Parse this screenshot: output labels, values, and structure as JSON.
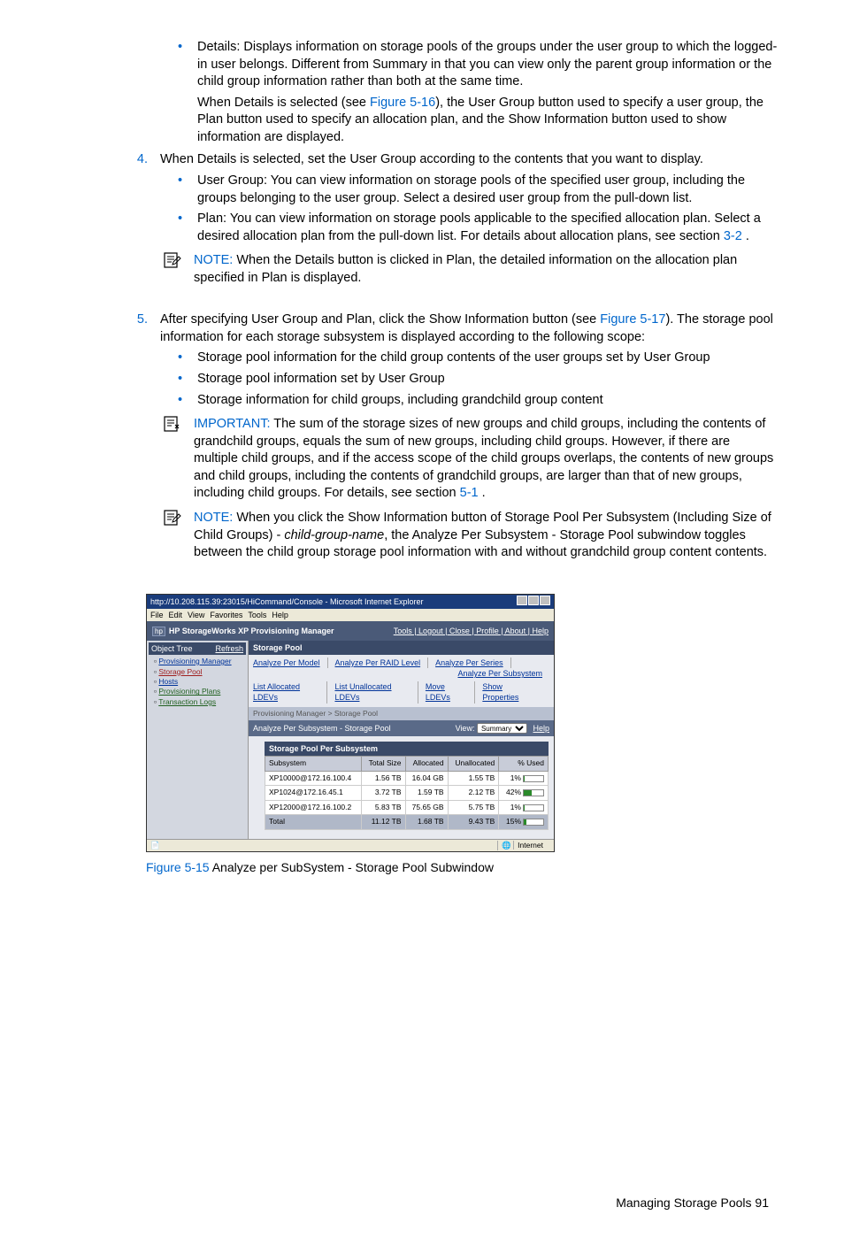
{
  "bullets_top": {
    "details_desc": "Details: Displays information on storage pools of the groups under the user group to which the logged-in user belongs. Different from Summary in that you can view only the parent group information or the child group information rather than both at the same time.",
    "details_para_before": "When Details is selected (see ",
    "details_link": "Figure 5-16",
    "details_para_after": "), the User Group button used to specify a user group, the Plan button used to specify an allocation plan, and the Show Information button used to show information are displayed."
  },
  "step4": {
    "num": "4.",
    "text": "When Details is selected, set the User Group according to the contents that you want to display.",
    "ug_bullet": "User Group: You can view information on storage pools of the specified user group, including the groups belonging to the user group. Select a desired user group from the pull-down list.",
    "plan_bullet_before": "Plan: You can view information on storage pools applicable to the specified allocation plan. Select a desired allocation plan from the pull-down list. For details about allocation plans, see section ",
    "plan_link": "3-2",
    "plan_bullet_after": " .",
    "note_label": "NOTE:  ",
    "note_text": "When the Details button is clicked in Plan, the detailed information on the allocation plan specified in Plan is displayed."
  },
  "step5": {
    "num": "5.",
    "text_before": "After specifying User Group and Plan, click the Show Information button (see ",
    "link": "Figure 5-17",
    "text_after": "). The storage pool information for each storage subsystem is displayed according to the following scope:",
    "b1": "Storage pool information for the child group contents of the user groups set by User Group",
    "b2": "Storage pool information set by User Group",
    "b3": "Storage information for child groups, including grandchild group content",
    "imp_label": "IMPORTANT:  ",
    "imp_before": "The sum of the storage sizes of new groups and child groups, including the contents of grandchild groups, equals the sum of new groups, including child groups. However, if there are multiple child groups, and if the access scope of the child groups overlaps, the contents of new groups and child groups, including the contents of grandchild groups, are larger than that of new groups, including child groups. For details, see section ",
    "imp_link": "5-1",
    "imp_after": " .",
    "note2_label": "NOTE:  ",
    "note2_before": "When you click the Show Information button of Storage Pool Per Subsystem (Including Size of Child Groups) - ",
    "note2_italic": "child-group-name",
    "note2_after": ", the Analyze Per Subsystem - Storage Pool subwindow toggles between the child group storage pool information with and without grandchild group content contents."
  },
  "faux": {
    "titlebar": "http://10.208.115.39:23015/HiCommand/Console - Microsoft Internet Explorer",
    "menus": [
      "File",
      "Edit",
      "View",
      "Favorites",
      "Tools",
      "Help"
    ],
    "appname": "HP StorageWorks XP Provisioning Manager",
    "applinks": "Tools | Logout | Close | Profile | About | Help",
    "tree_hdr": "Object Tree",
    "tree_refresh": "Refresh",
    "tree_items": [
      {
        "cls": "",
        "label": "Provisioning Manager"
      },
      {
        "cls": "red",
        "label": "Storage Pool"
      },
      {
        "cls": "",
        "label": "Hosts"
      },
      {
        "cls": "green",
        "label": "Provisioning Plans"
      },
      {
        "cls": "green",
        "label": "Transaction Logs"
      }
    ],
    "main_hdr": "Storage Pool",
    "linkbar1": [
      "Analyze Per Model",
      "Analyze Per RAID Level",
      "Analyze Per Series",
      "Analyze Per Subsystem"
    ],
    "linkbar2": [
      "List Allocated LDEVs",
      "List Unallocated LDEVs",
      "Move LDEVs",
      "Show Properties"
    ],
    "crumb": "Provisioning Manager > Storage Pool",
    "subhdr": "Analyze Per Subsystem - Storage Pool",
    "view_label": "View:",
    "view_opt": "Summary",
    "help": "Help",
    "tbl_title": "Storage Pool Per Subsystem",
    "cols": [
      "Subsystem",
      "Total Size",
      "Allocated",
      "Unallocated",
      "% Used"
    ],
    "rows": [
      {
        "sub": "XP10000@172.16.100.4",
        "total": "1.56 TB",
        "alloc": "16.04 GB",
        "unalloc": "1.55 TB",
        "used": "1%",
        "pct": 1
      },
      {
        "sub": "XP1024@172.16.45.1",
        "total": "3.72 TB",
        "alloc": "1.59 TB",
        "unalloc": "2.12 TB",
        "used": "42%",
        "pct": 42
      },
      {
        "sub": "XP12000@172.16.100.2",
        "total": "5.83 TB",
        "alloc": "75.65 GB",
        "unalloc": "5.75 TB",
        "used": "1%",
        "pct": 1
      }
    ],
    "total": {
      "sub": "Total",
      "total": "11.12 TB",
      "alloc": "1.68 TB",
      "unalloc": "9.43 TB",
      "used": "15%",
      "pct": 15
    },
    "status_right": "Internet"
  },
  "figure_caption_label": "Figure 5-15",
  "figure_caption_text": " Analyze per SubSystem - Storage Pool Subwindow",
  "footer": "Managing Storage Pools  91"
}
